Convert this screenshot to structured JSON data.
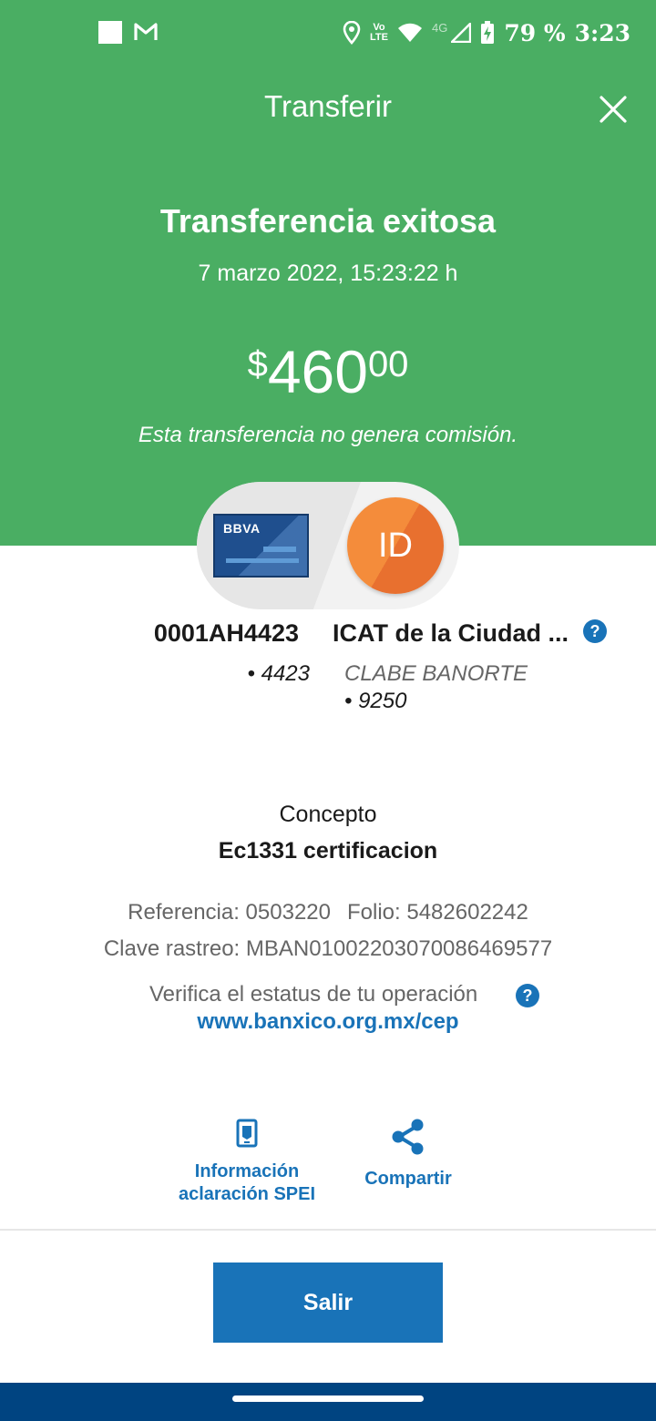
{
  "status_bar": {
    "volte_line1": "Vo",
    "volte_line2": "LTE",
    "network": "4G",
    "battery": "79 %",
    "time": "3:23"
  },
  "header": {
    "title": "Transferir",
    "close_icon": "close-icon"
  },
  "summary": {
    "title": "Transferencia exitosa",
    "datetime": "7 marzo 2022, 15:23:22 h",
    "amount_currency": "$",
    "amount_integer": "460",
    "amount_decimals": "00",
    "commission_note": "Esta transferencia no genera comisión."
  },
  "transfer": {
    "origin_bank_logo": "BBVA",
    "origin_account_name": "0001AH4423",
    "origin_account_number": "• 4423",
    "destination_initials": "ID",
    "destination_name": "ICAT de la Ciudad ...",
    "destination_bank": "CLABE BANORTE",
    "destination_account_number": "• 9250",
    "help": "?"
  },
  "details": {
    "concept_label": "Concepto",
    "concept_value": "Ec1331 certificacion",
    "reference": "Referencia: 0503220",
    "folio": "Folio: 5482602242",
    "tracking_key": "Clave rastreo: MBAN01002203070086469577",
    "verify_text": "Verifica el estatus de tu operación",
    "verify_help": "?",
    "verify_link": "www.banxico.org.mx/cep"
  },
  "actions": {
    "info_line1": "Información",
    "info_line2": "aclaración SPEI",
    "share": "Compartir"
  },
  "footer": {
    "exit_label": "Salir"
  },
  "colors": {
    "header_green": "#4aae63",
    "accent_blue": "#1973b8",
    "nav_blue": "#004481",
    "avatar_orange": "#f48c3b"
  }
}
